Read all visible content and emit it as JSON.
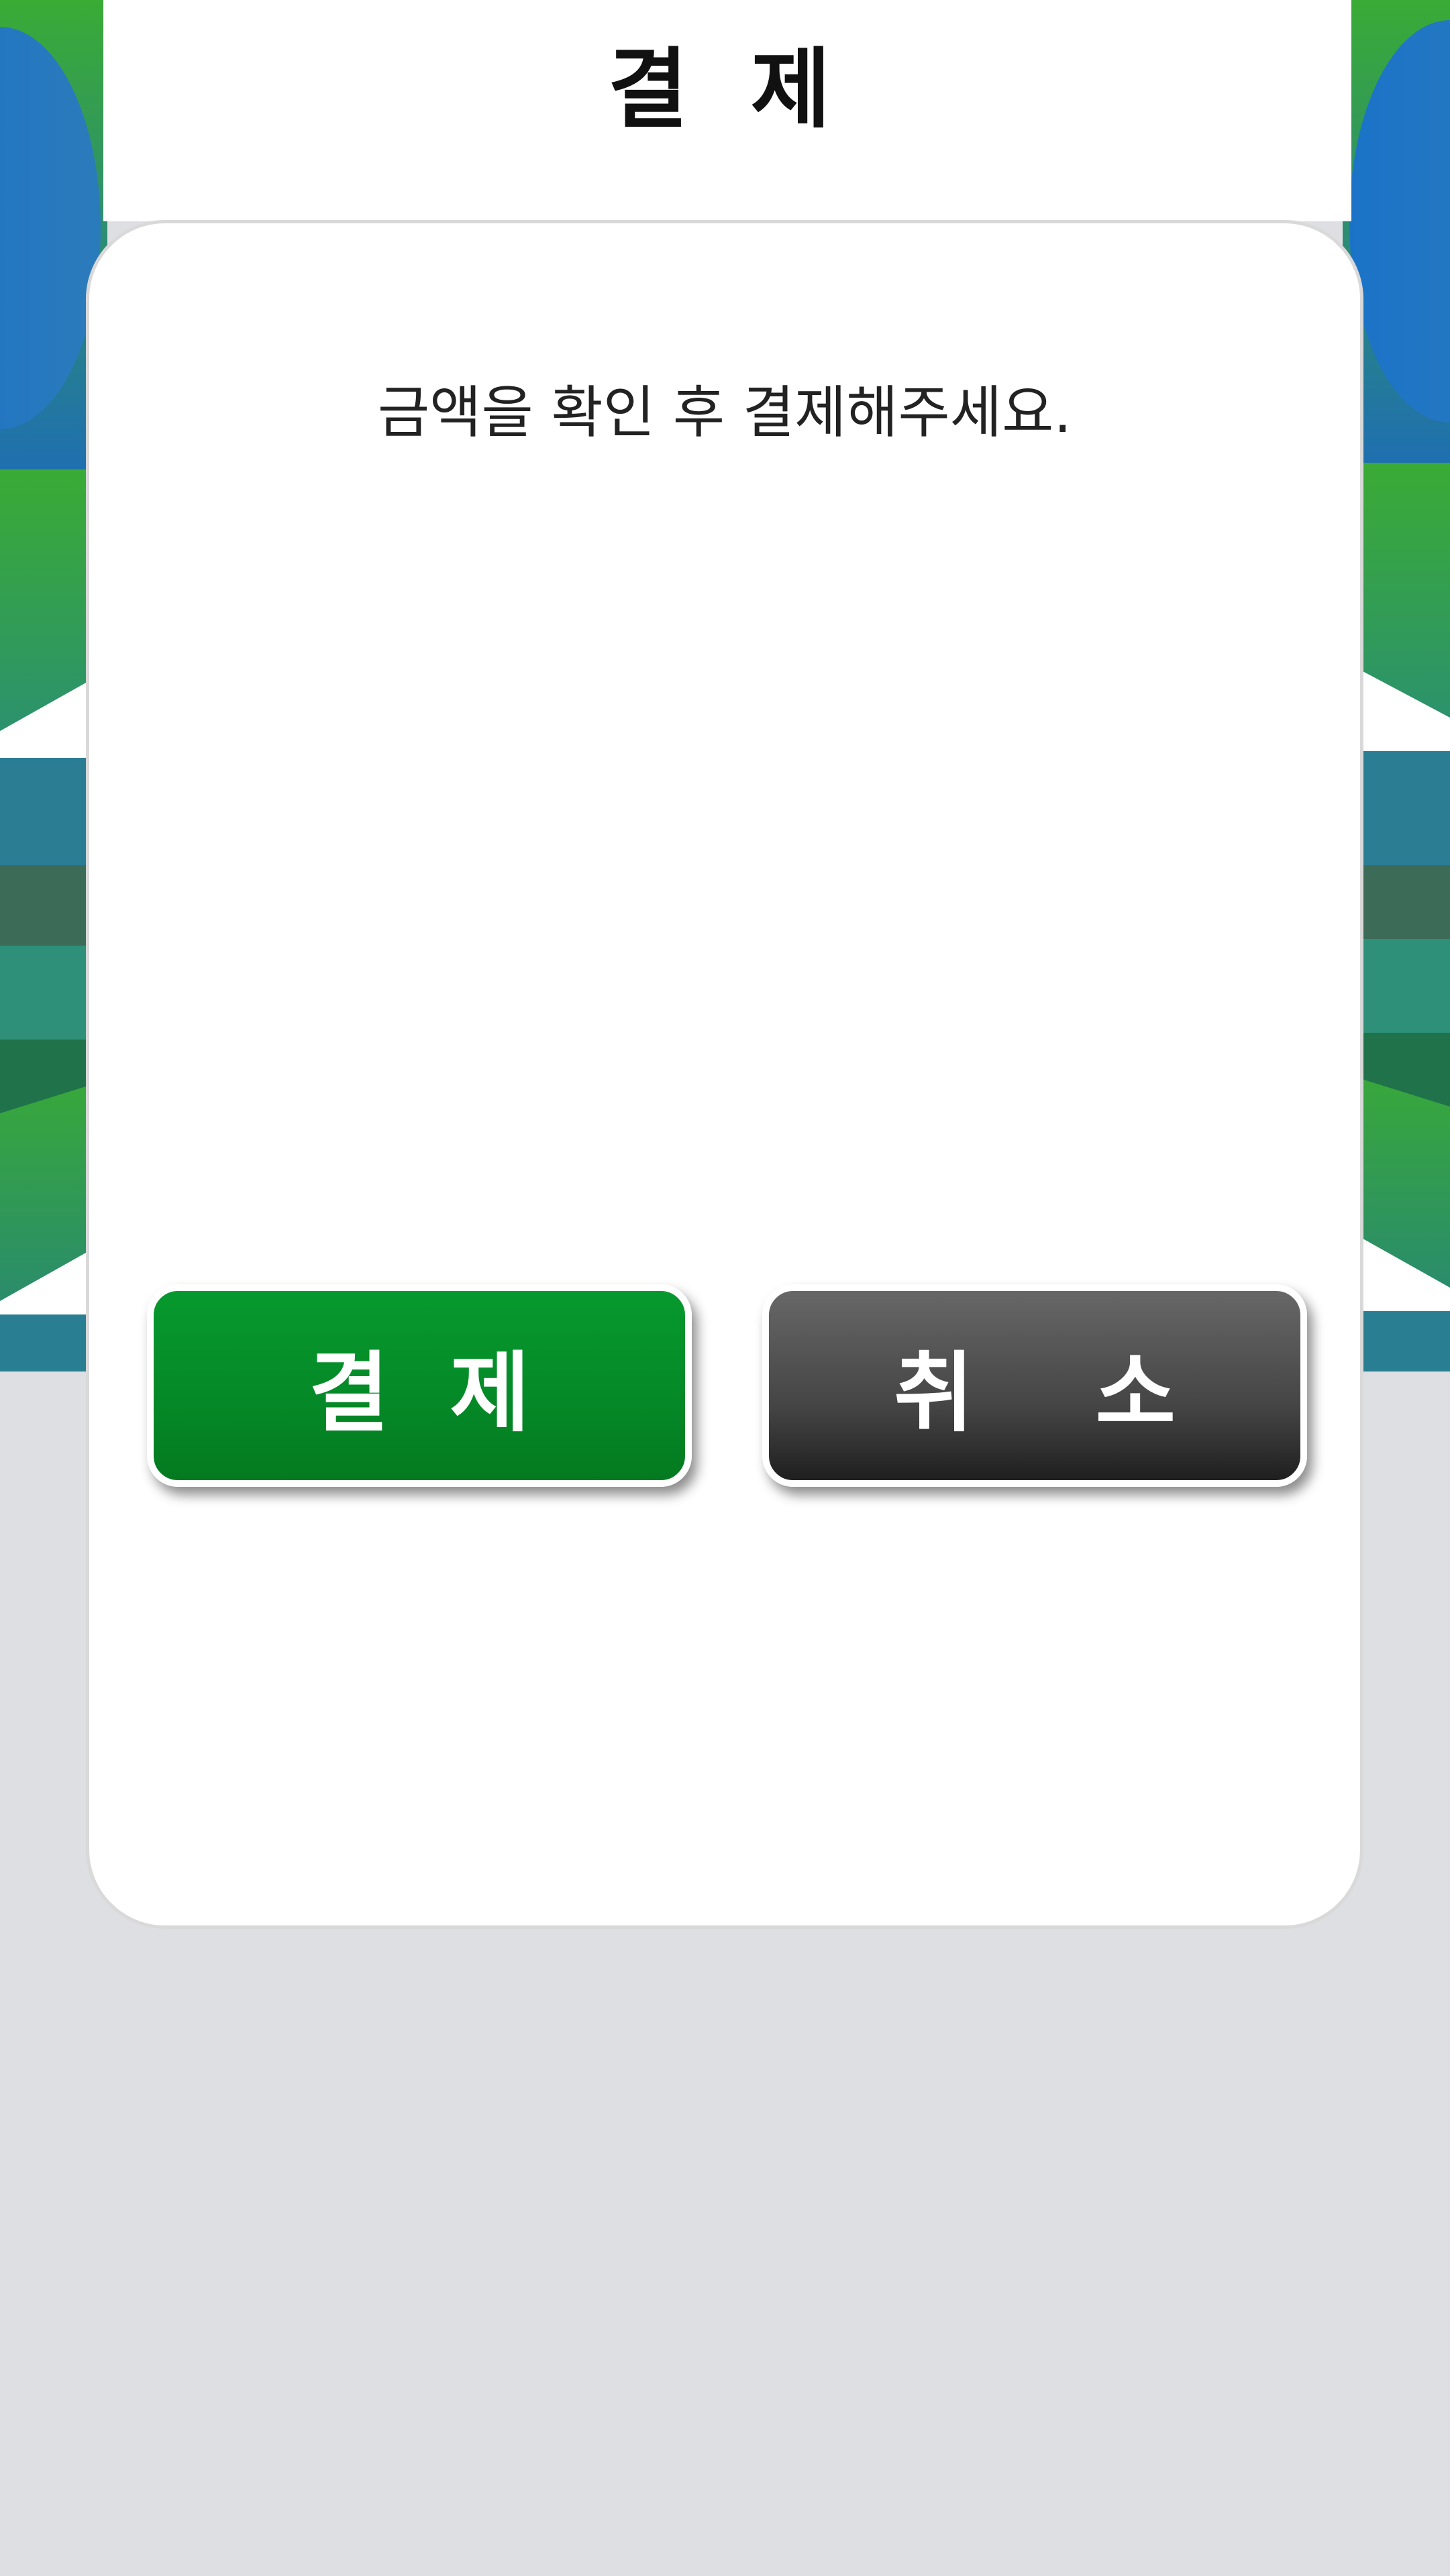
{
  "header": {
    "title": "결 제"
  },
  "dialog": {
    "message": "금액을 확인 후 결제해주세요.",
    "confirm_label": "결  제",
    "cancel_label": "취    소"
  },
  "colors": {
    "confirm_button": "#058a28",
    "cancel_button": "#444444",
    "backdrop": "#dedfe2",
    "card": "#ffffff"
  }
}
